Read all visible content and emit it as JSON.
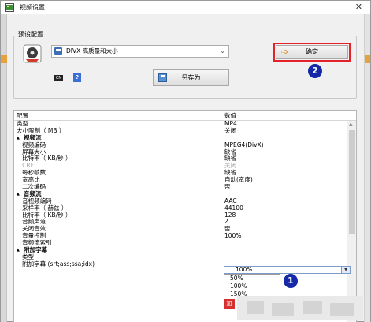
{
  "window": {
    "title": "视频设置",
    "close": "✕"
  },
  "preset": {
    "group_label": "预设配置",
    "selected": "DIVX 高质量和大小",
    "save_as_label": "另存为",
    "ok_label": "确定",
    "small_icon_1": "CN",
    "small_icon_2": "?"
  },
  "annotations": {
    "badge_2": "2",
    "badge_1": "1"
  },
  "table": {
    "headers": {
      "key": "配置",
      "value": "数值"
    },
    "rows": [
      {
        "k": "类型",
        "v": "MP4",
        "kind": "row"
      },
      {
        "k": "大小限制（ MB ）",
        "v": "关闭",
        "kind": "row"
      },
      {
        "k": "视频流",
        "v": "",
        "kind": "sec",
        "tw": "▲"
      },
      {
        "k": "   视频编码",
        "v": "MPEG4(DivX)",
        "kind": "row"
      },
      {
        "k": "   屏幕大小",
        "v": "缺省",
        "kind": "row"
      },
      {
        "k": "   比特率（ KB/秒 ）",
        "v": "缺省",
        "kind": "row"
      },
      {
        "k": "   CRF",
        "v": "关闭",
        "kind": "dis"
      },
      {
        "k": "   每秒帧数",
        "v": "缺省",
        "kind": "row"
      },
      {
        "k": "   宽高比",
        "v": "自动(宽度)",
        "kind": "row"
      },
      {
        "k": "   二次编码",
        "v": "否",
        "kind": "row"
      },
      {
        "k": "音频流",
        "v": "",
        "kind": "sec",
        "tw": "▲"
      },
      {
        "k": "   音视频编码",
        "v": "AAC",
        "kind": "row"
      },
      {
        "k": "   采样率（ 赫兹 ）",
        "v": "44100",
        "kind": "row"
      },
      {
        "k": "   比特率（ KB/秒 ）",
        "v": "128",
        "kind": "row"
      },
      {
        "k": "   音频声道",
        "v": "2",
        "kind": "row"
      },
      {
        "k": "   关闭音效",
        "v": "否",
        "kind": "row"
      },
      {
        "k": "   音量控制",
        "v": "100%",
        "kind": "row"
      },
      {
        "k": "   音频流索引",
        "v": "",
        "kind": "row"
      },
      {
        "k": "附加字幕",
        "v": "",
        "kind": "sec",
        "tw": "▲"
      },
      {
        "k": "   类型",
        "v": "",
        "kind": "row"
      },
      {
        "k": "   附加字幕 (srt;ass;ssa;idx)",
        "v": "",
        "kind": "row"
      }
    ]
  },
  "volume_combo": {
    "value": "100%",
    "options": [
      "50%",
      "100%",
      "150%"
    ]
  },
  "subtitle_button_label": "加"
}
